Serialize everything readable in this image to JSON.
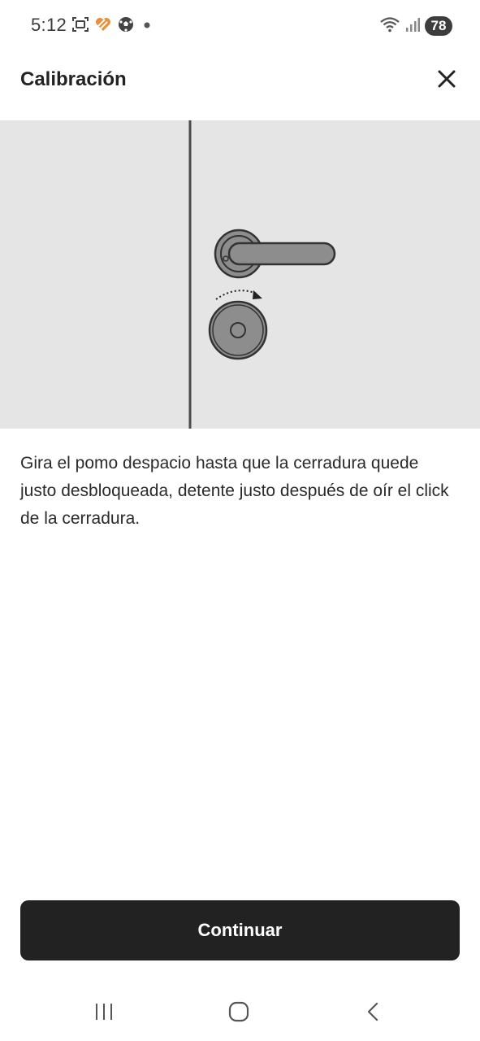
{
  "status_bar": {
    "time": "5:12",
    "battery": "78",
    "icons": [
      "screenshot-icon",
      "heart-app-icon",
      "soccer-ball-icon",
      "notification-dot-icon",
      "wifi-icon",
      "signal-icon"
    ]
  },
  "header": {
    "title": "Calibración",
    "close_icon": "close-icon"
  },
  "illustration": {
    "subject": "door-lock-icon",
    "background_color": "#e5e5e5"
  },
  "instructions": {
    "text": "Gira el pomo despacio hasta que la cerradura quede justo desbloqueada, detente justo después de oír el click de la cerradura."
  },
  "actions": {
    "continue_label": "Continuar",
    "button_color": "#222222"
  },
  "nav_bar": {
    "icons": [
      "recent-apps-icon",
      "home-icon",
      "back-icon"
    ]
  }
}
